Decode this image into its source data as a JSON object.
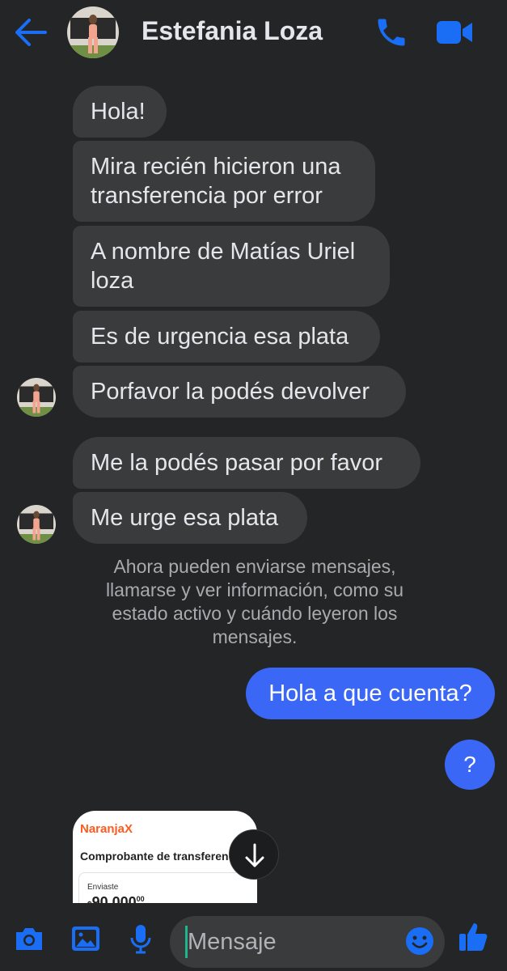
{
  "header": {
    "contact_name": "Estefania Loza",
    "back_icon": "arrow-left-icon",
    "call_icon": "phone-icon",
    "video_icon": "video-camera-icon",
    "accent_color": "#1a6ef5"
  },
  "messages": {
    "incoming": [
      "Hola!",
      "Mira recién hicieron una transferencia por error",
      "A nombre de Matías Uriel loza",
      "Es de urgencia esa plata",
      "Porfavor la podés devolver",
      "Me la podés pasar por favor",
      "Me urge esa plata"
    ],
    "system_notice": "Ahora pueden enviarse mensajes, llamarse y ver información, como su estado activo y cuándo leyeron los mensajes.",
    "outgoing": [
      "Hola a que cuenta?",
      "?"
    ],
    "outgoing_color": "#3a67f5"
  },
  "receipt": {
    "brand": "NaranjaX",
    "title": "Comprobante de transferencia",
    "label": "Enviaste",
    "amount_prefix": "$",
    "amount": "90.000",
    "amount_cents": "00"
  },
  "composer": {
    "placeholder": "Mensaje",
    "icons": [
      "camera-icon",
      "image-icon",
      "microphone-icon",
      "emoji-icon",
      "thumbs-up-icon"
    ]
  }
}
